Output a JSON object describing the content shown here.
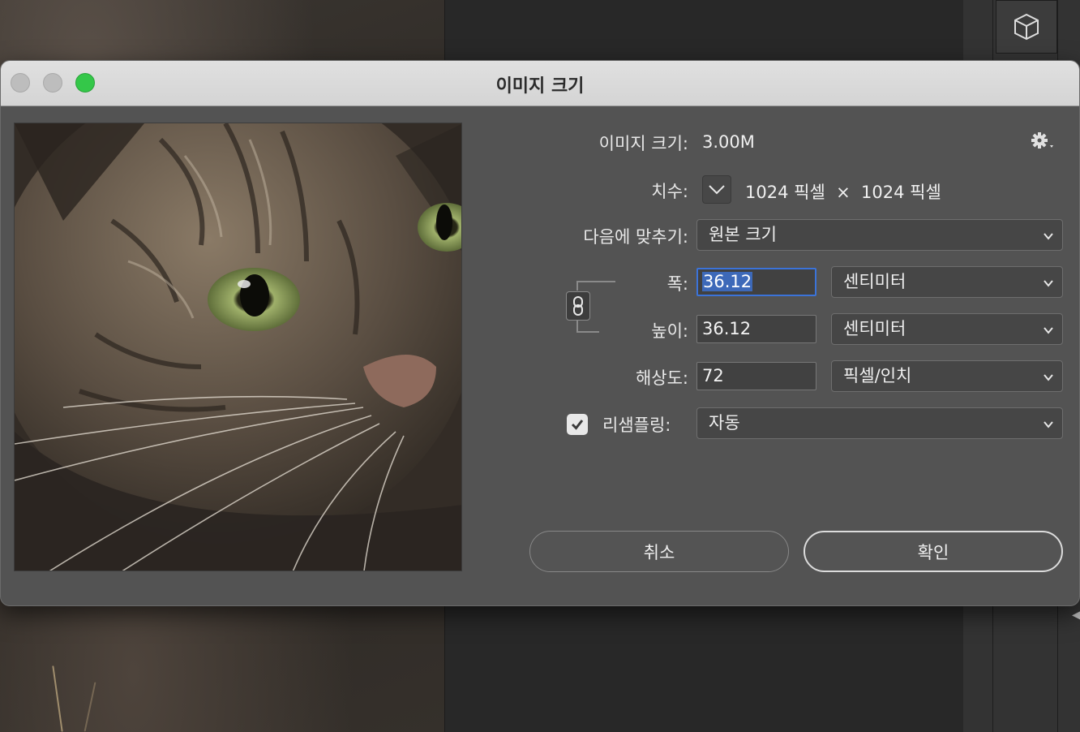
{
  "dialog": {
    "title": "이미지 크기",
    "image_size_label": "이미지 크기:",
    "image_size_value": "3.00M",
    "dimensions_label": "치수:",
    "dimensions_value": "1024 픽셀  ×  1024 픽셀",
    "fit_label": "다음에 맞추기:",
    "fit_value": "원본 크기",
    "width_label": "폭:",
    "width_value": "36.12",
    "width_unit": "센티미터",
    "height_label": "높이:",
    "height_value": "36.12",
    "height_unit": "센티미터",
    "resolution_label": "해상도:",
    "resolution_value": "72",
    "resolution_unit": "픽셀/인치",
    "resample_label": "리샘플링:",
    "resample_checked": true,
    "resample_value": "자동",
    "cancel_label": "취소",
    "ok_label": "확인"
  },
  "icons": {
    "settings": "gear-icon",
    "constrain": "link-icon",
    "dimensions_toggle": "chevron-down-icon",
    "background_panel": "cube-icon"
  },
  "colors": {
    "dialog_bg": "#535353",
    "titlebar_bg": "#d8d8d8",
    "focus_border": "#3b73d9",
    "zoom_button": "#34c749"
  }
}
